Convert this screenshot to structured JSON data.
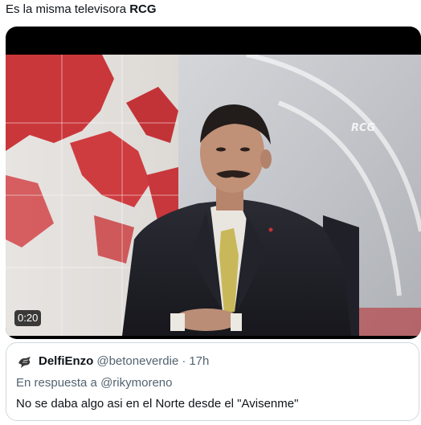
{
  "tweet": {
    "text_prefix": "Es la misma televisora ",
    "text_bold": "RCG"
  },
  "media": {
    "duration": "0:20",
    "channel_watermark": "RCG"
  },
  "quoted_tweet": {
    "avatar_icon": "bird-avatar-icon",
    "display_name": "DelfiEnzo",
    "handle": "@betoneverdie",
    "separator": "·",
    "time": "17h",
    "reply_prefix": "En respuesta a ",
    "reply_to": "@rikymoreno",
    "text": "No se daba algo asi en el Norte desde el \"Avisenme\""
  }
}
